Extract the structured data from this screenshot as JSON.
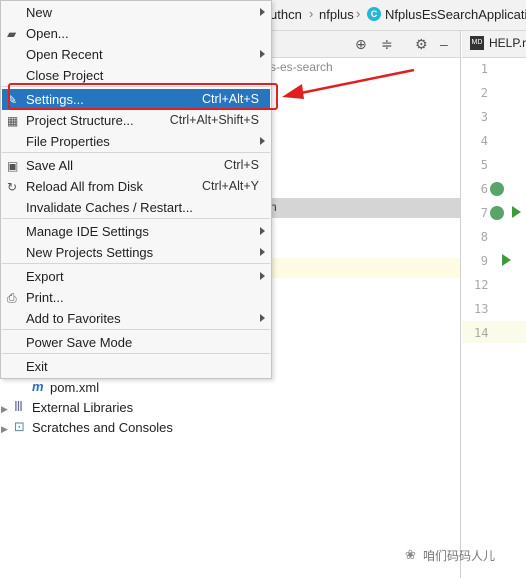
{
  "breadcrumbs": {
    "item1": "uthcn",
    "item2": "nfplus",
    "item3": "NfplusEsSearchApplicati"
  },
  "project_panel": {
    "path_fragment": "s-es-search",
    "selected_fragment": "n",
    "tree": [
      {
        "label": "pom.xml",
        "icon": "maven-icon"
      },
      {
        "label": "External Libraries",
        "icon": "libraries-icon"
      },
      {
        "label": "Scratches and Consoles",
        "icon": "scratches-icon"
      }
    ]
  },
  "editor": {
    "tab_badge": "MD",
    "tab_label": "HELP.r",
    "line_numbers": [
      "1",
      "2",
      "3",
      "4",
      "5",
      "6",
      "7",
      "8",
      "9",
      "12",
      "13",
      "14"
    ]
  },
  "menu": {
    "items": [
      {
        "label": "New",
        "shortcut": "",
        "submenu": true,
        "icon": ""
      },
      {
        "label": "Open...",
        "shortcut": "",
        "submenu": false,
        "icon": "folder-icon"
      },
      {
        "label": "Open Recent",
        "shortcut": "",
        "submenu": true,
        "icon": ""
      },
      {
        "label": "Close Project",
        "shortcut": "",
        "submenu": false,
        "icon": ""
      },
      {
        "label": "Settings...",
        "shortcut": "Ctrl+Alt+S",
        "submenu": false,
        "icon": "wrench-icon",
        "selected": true
      },
      {
        "label": "Project Structure...",
        "shortcut": "Ctrl+Alt+Shift+S",
        "submenu": false,
        "icon": "structure-icon"
      },
      {
        "label": "File Properties",
        "shortcut": "",
        "submenu": true,
        "icon": ""
      },
      {
        "label": "Save All",
        "shortcut": "Ctrl+S",
        "submenu": false,
        "icon": "save-icon"
      },
      {
        "label": "Reload All from Disk",
        "shortcut": "Ctrl+Alt+Y",
        "submenu": false,
        "icon": "reload-icon"
      },
      {
        "label": "Invalidate Caches / Restart...",
        "shortcut": "",
        "submenu": false,
        "icon": ""
      },
      {
        "label": "Manage IDE Settings",
        "shortcut": "",
        "submenu": true,
        "icon": ""
      },
      {
        "label": "New Projects Settings",
        "shortcut": "",
        "submenu": true,
        "icon": ""
      },
      {
        "label": "Export",
        "shortcut": "",
        "submenu": true,
        "icon": ""
      },
      {
        "label": "Print...",
        "shortcut": "",
        "submenu": false,
        "icon": "print-icon"
      },
      {
        "label": "Add to Favorites",
        "shortcut": "",
        "submenu": true,
        "icon": ""
      },
      {
        "label": "Power Save Mode",
        "shortcut": "",
        "submenu": false,
        "icon": ""
      },
      {
        "label": "Exit",
        "shortcut": "",
        "submenu": false,
        "icon": ""
      }
    ]
  },
  "watermark": "咱们码码人儿",
  "colors": {
    "selection": "#2675bf",
    "annotation": "#e02020"
  }
}
